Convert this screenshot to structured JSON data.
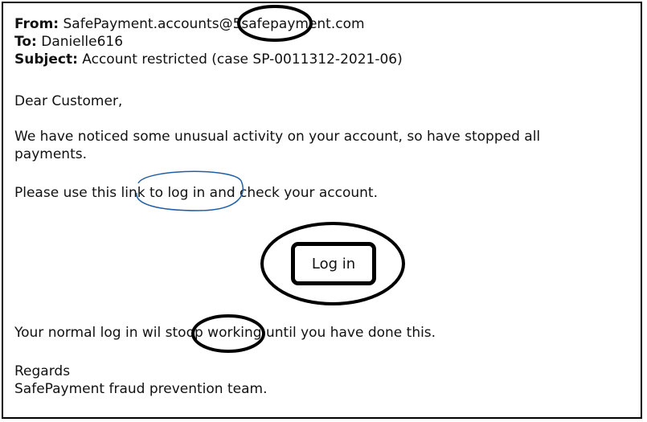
{
  "header": {
    "from_label": "From:",
    "from_value": "SafePayment.accounts@5safepayment.com",
    "to_label": "To:",
    "to_value": "Danielle616",
    "subject_label": "Subject:",
    "subject_value": "Account restricted (case SP-0011312-2021-06)"
  },
  "body": {
    "greeting": "Dear Customer,",
    "para1_line1": "We have noticed some unusual activity on your account, so have stopped all",
    "para1_line2": "payments.",
    "para2_before": "Please use this ",
    "para2_link": "link to log in",
    "para2_after": " and check your account.",
    "login_button": "Log in",
    "para3_before": "Your normal log in wil ",
    "para3_error": "stoop",
    "para3_after": " working until you have done this.",
    "closing": "Regards",
    "signature": "SafePayment fraud prevention team."
  },
  "colors": {
    "link_annotation": "#1f5fa8",
    "annotation": "#000000"
  }
}
